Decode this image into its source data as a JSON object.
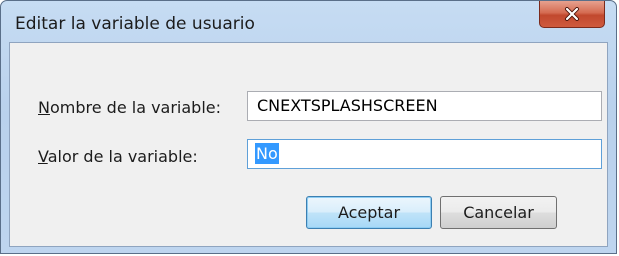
{
  "window": {
    "title": "Editar la variable de usuario",
    "close_icon": "close-icon"
  },
  "form": {
    "name_label_accel": "N",
    "name_label_rest": "ombre de la variable:",
    "name_value": "CNEXTSPLASHSCREEN",
    "value_label_accel": "V",
    "value_label_rest": "alor de la variable:",
    "value_value": "No"
  },
  "buttons": {
    "ok_label": "Aceptar",
    "cancel_label": "Cancelar"
  },
  "colors": {
    "close_button": "#c1482e",
    "selection": "#3399ff",
    "default_button_border": "#3c7fb1"
  }
}
